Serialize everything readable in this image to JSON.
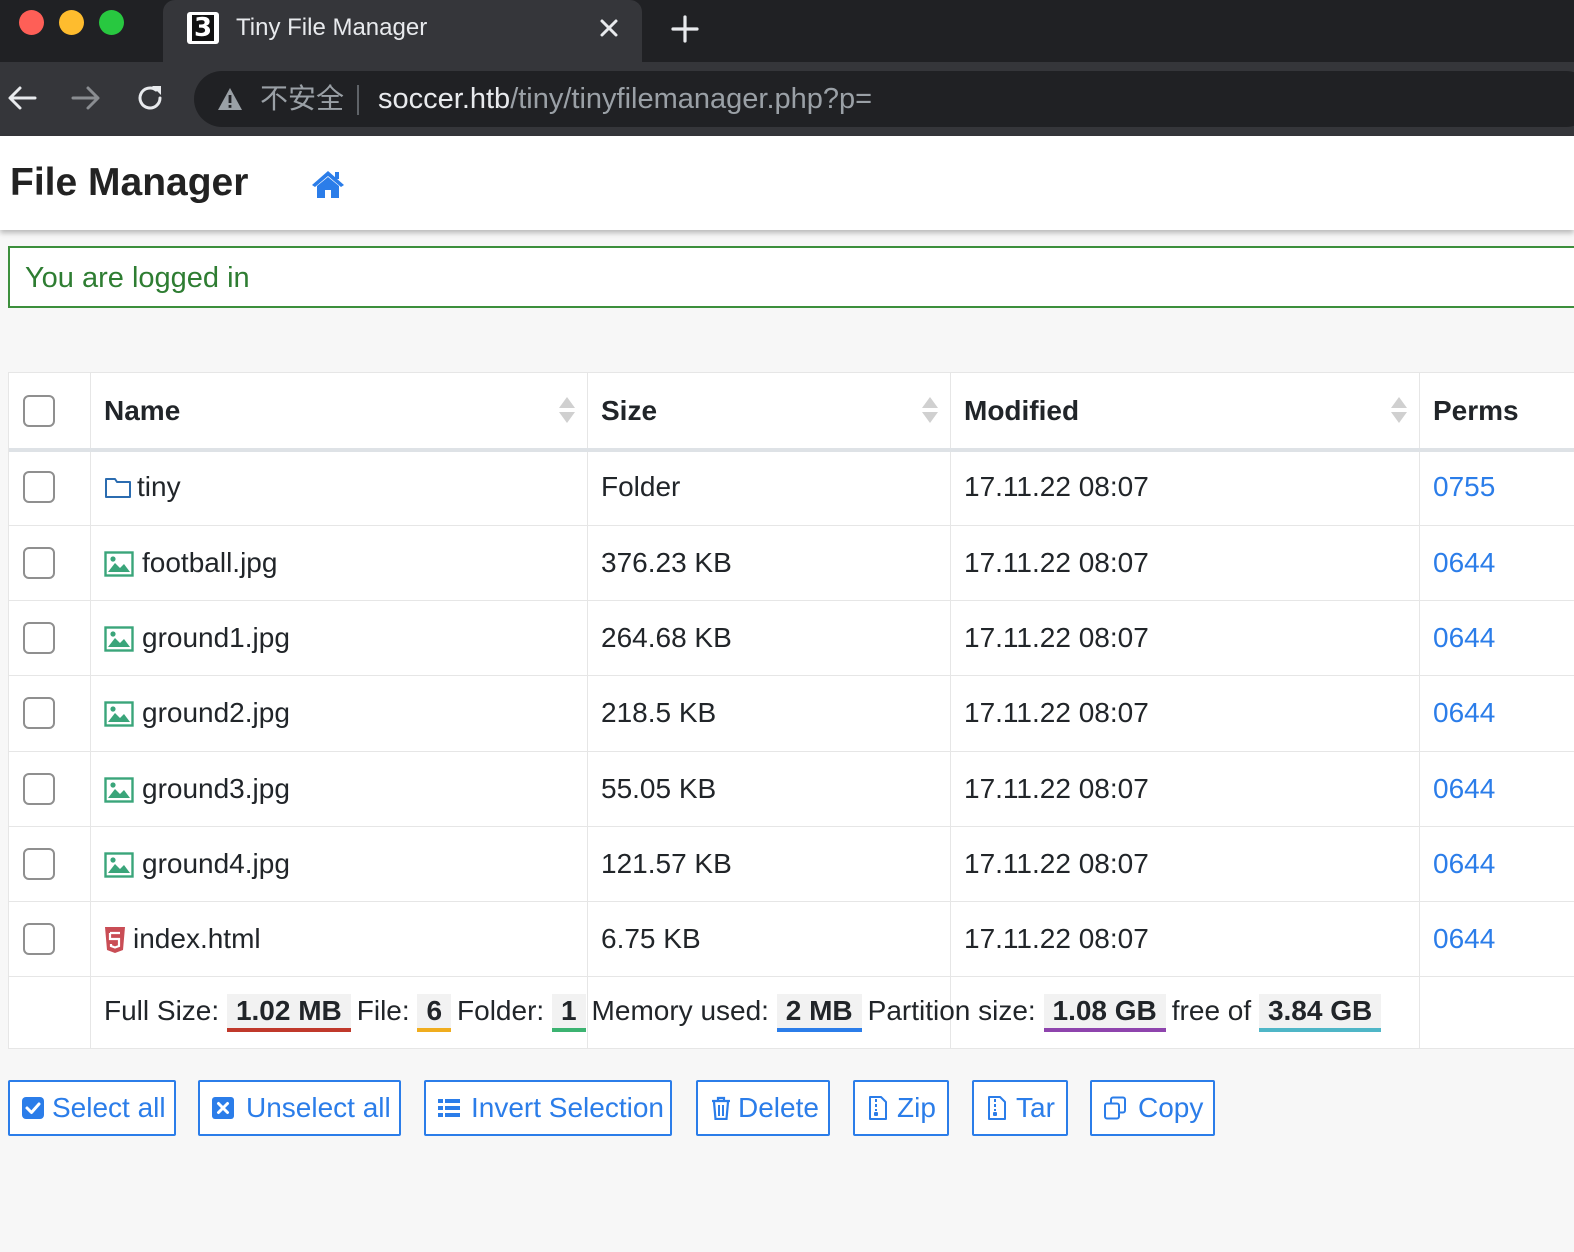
{
  "browser": {
    "tab_title": "Tiny File Manager",
    "security_label": "不安全",
    "url_host": "soccer.htb",
    "url_path": "/tiny/tinyfilemanager.php?p="
  },
  "navbar": {
    "brand": "File Manager"
  },
  "alert": {
    "message": "You are logged in"
  },
  "table": {
    "headers": {
      "name": "Name",
      "size": "Size",
      "modified": "Modified",
      "perms": "Perms"
    },
    "rows": [
      {
        "name": "tiny",
        "size": "Folder",
        "modified": "17.11.22 08:07",
        "perms": "0755",
        "icon": "folder-icon"
      },
      {
        "name": "football.jpg",
        "size": "376.23 KB",
        "modified": "17.11.22 08:07",
        "perms": "0644",
        "icon": "image-icon"
      },
      {
        "name": "ground1.jpg",
        "size": "264.68 KB",
        "modified": "17.11.22 08:07",
        "perms": "0644",
        "icon": "image-icon"
      },
      {
        "name": "ground2.jpg",
        "size": "218.5 KB",
        "modified": "17.11.22 08:07",
        "perms": "0644",
        "icon": "image-icon"
      },
      {
        "name": "ground3.jpg",
        "size": "55.05 KB",
        "modified": "17.11.22 08:07",
        "perms": "0644",
        "icon": "image-icon"
      },
      {
        "name": "ground4.jpg",
        "size": "121.57 KB",
        "modified": "17.11.22 08:07",
        "perms": "0644",
        "icon": "image-icon"
      },
      {
        "name": "index.html",
        "size": "6.75 KB",
        "modified": "17.11.22 08:07",
        "perms": "0644",
        "icon": "html5-icon"
      }
    ],
    "footer": {
      "full_size_label": "Full Size:",
      "full_size": "1.02 MB",
      "file_label": "File:",
      "file_count": "6",
      "folder_label": "Folder:",
      "folder_count": "1",
      "memory_label": "Memory used:",
      "memory": "2 MB",
      "partition_label": "Partition size:",
      "partition_free": "1.08 GB",
      "free_of_label": "free of",
      "partition_total": "3.84 GB"
    }
  },
  "actions": {
    "select_all": "Select all",
    "unselect_all": "Unselect all",
    "invert_selection": "Invert Selection",
    "delete": "Delete",
    "zip": "Zip",
    "tar": "Tar",
    "copy": "Copy"
  },
  "colors": {
    "accent": "#2b7de9",
    "success": "#3c8f3c",
    "full_size_bar": "#c0392b",
    "file_bar": "#f0ad1e",
    "folder_bar": "#3cb371",
    "memory_bar": "#2b7de9",
    "partition_bar": "#8e44ad",
    "total_bar": "#4fb6c7"
  }
}
